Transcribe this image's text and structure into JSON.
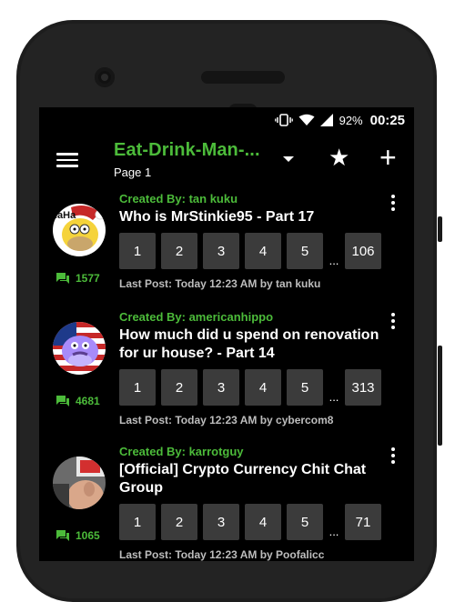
{
  "status_bar": {
    "battery_percent": "92%",
    "time": "00:25",
    "icons": [
      "vibrate-icon",
      "wifi-icon",
      "signal-icon",
      "battery-icon"
    ]
  },
  "app_bar": {
    "title": "Eat-Drink-Man-...",
    "subtitle": "Page 1",
    "icons": [
      "menu-icon",
      "dropdown-icon",
      "star-icon",
      "add-icon"
    ]
  },
  "colors": {
    "accent": "#4cbb3a",
    "background": "#000000",
    "page_button": "#3b3b3b"
  },
  "threads": [
    {
      "creator": "Created By: tan kuku",
      "title": "Who is MrStinkie95 - Part 17",
      "reply_count": "1577",
      "pages": [
        "1",
        "2",
        "3",
        "4",
        "5"
      ],
      "ellipsis": "...",
      "last_page": "106",
      "last_post": "Last Post: Today 12:23 AM by tan kuku"
    },
    {
      "creator": "Created By: americanhippo",
      "title": "How much did u spend on renovation for ur house? - Part 14",
      "reply_count": "4681",
      "pages": [
        "1",
        "2",
        "3",
        "4",
        "5"
      ],
      "ellipsis": "...",
      "last_page": "313",
      "last_post": "Last Post: Today 12:23 AM by cybercom8"
    },
    {
      "creator": "Created By: karrotguy",
      "title": "[Official] Crypto Currency Chit Chat Group",
      "reply_count": "1065",
      "pages": [
        "1",
        "2",
        "3",
        "4",
        "5"
      ],
      "ellipsis": "...",
      "last_page": "71",
      "last_post": "Last Post: Today 12:23 AM by Poofalicc"
    }
  ]
}
